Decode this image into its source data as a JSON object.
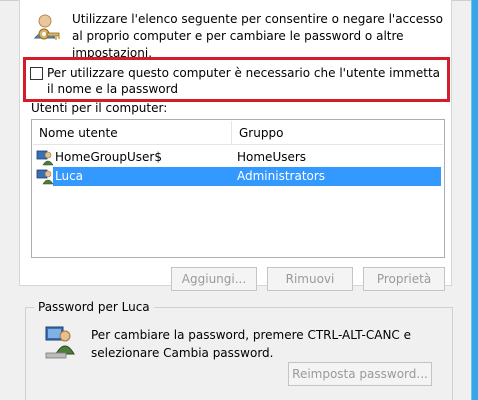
{
  "intro": {
    "text": "Utilizzare l'elenco seguente per consentire o negare l'accesso al proprio computer e per cambiare le password o altre impostazioni.",
    "icon": "users-icon"
  },
  "require_login": {
    "checked": false,
    "label": "Per utilizzare questo computer è necessario che l'utente immetta il nome e la password"
  },
  "users_list": {
    "label": "Utenti per il computer:",
    "columns": [
      "Nome utente",
      "Gruppo"
    ],
    "rows": [
      {
        "name": "HomeGroupUser$",
        "group": "HomeUsers",
        "selected": false
      },
      {
        "name": "Luca",
        "group": "Administrators",
        "selected": true
      }
    ]
  },
  "buttons": {
    "add": "Aggiungi...",
    "remove": "Rimuovi",
    "properties": "Proprietà",
    "reset_password": "Reimposta password..."
  },
  "password_group": {
    "title": "Password per Luca",
    "text": "Per cambiare la password, premere CTRL-ALT-CANC e selezionare Cambia password."
  },
  "colors": {
    "highlight": "#d21e2b",
    "selection": "#3399ff",
    "frame": "#35a7e8"
  }
}
